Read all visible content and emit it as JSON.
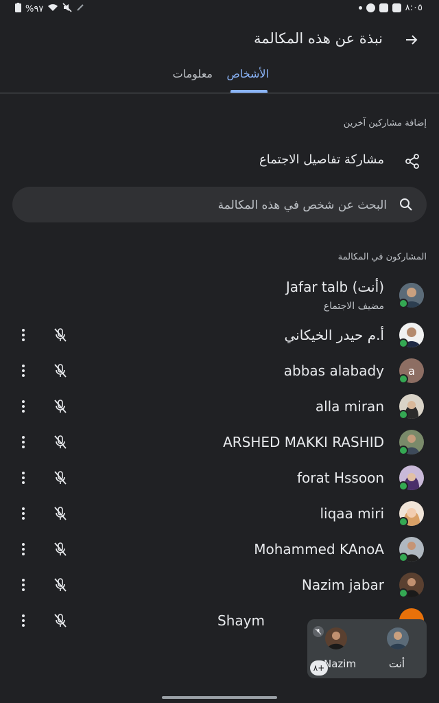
{
  "status_bar": {
    "battery": "%٩٧",
    "time": "٨:٠٥"
  },
  "header": {
    "title": "نبذة عن هذه المكالمة"
  },
  "tabs": [
    {
      "label": "الأشخاص",
      "active": true
    },
    {
      "label": "معلومات",
      "active": false
    }
  ],
  "add_section": {
    "label": "إضافة مشاركين آخرين",
    "share_label": "مشاركة تفاصيل الاجتماع"
  },
  "search": {
    "placeholder": "البحث عن شخص في هذه المكالمة"
  },
  "participants_section": {
    "label": "المشاركون في المكالمة"
  },
  "participants": [
    {
      "name": "Jafar talb (أنت)",
      "role": "مضيف الاجتماع",
      "avatar": "photo",
      "presence": "online"
    },
    {
      "name": "أ.م حيدر الخيكاني",
      "avatar": "photo",
      "mic": "off"
    },
    {
      "name": "abbas alabady",
      "avatar": "letter",
      "avatar_letter": "a",
      "avatar_color": "#8d6e63",
      "mic": "off"
    },
    {
      "name": "alla miran",
      "avatar": "photo",
      "mic": "off"
    },
    {
      "name": "ARSHED MAKKI RASHID",
      "avatar": "photo",
      "mic": "off"
    },
    {
      "name": "forat Hssoon",
      "avatar": "photo",
      "mic": "off"
    },
    {
      "name": "liqaa miri",
      "avatar": "photo",
      "mic": "off"
    },
    {
      "name": "Mohammed KAnoA",
      "avatar": "photo",
      "mic": "off"
    },
    {
      "name": "Nazim jabar",
      "avatar": "photo",
      "mic": "off"
    },
    {
      "name": "Shaym",
      "avatar": "photo",
      "mic": "off"
    }
  ],
  "pip": {
    "self_label": "أنت",
    "other_label": "Nazim",
    "extra_count": "٨+"
  },
  "colors": {
    "background": "#202124",
    "accent": "#8ab4f8",
    "presence": "#34a853"
  },
  "icons": {
    "back": "arrow-forward-icon",
    "share": "share-icon",
    "search": "search-icon",
    "more": "more-vert-icon",
    "mic_off": "mic-off-icon"
  }
}
